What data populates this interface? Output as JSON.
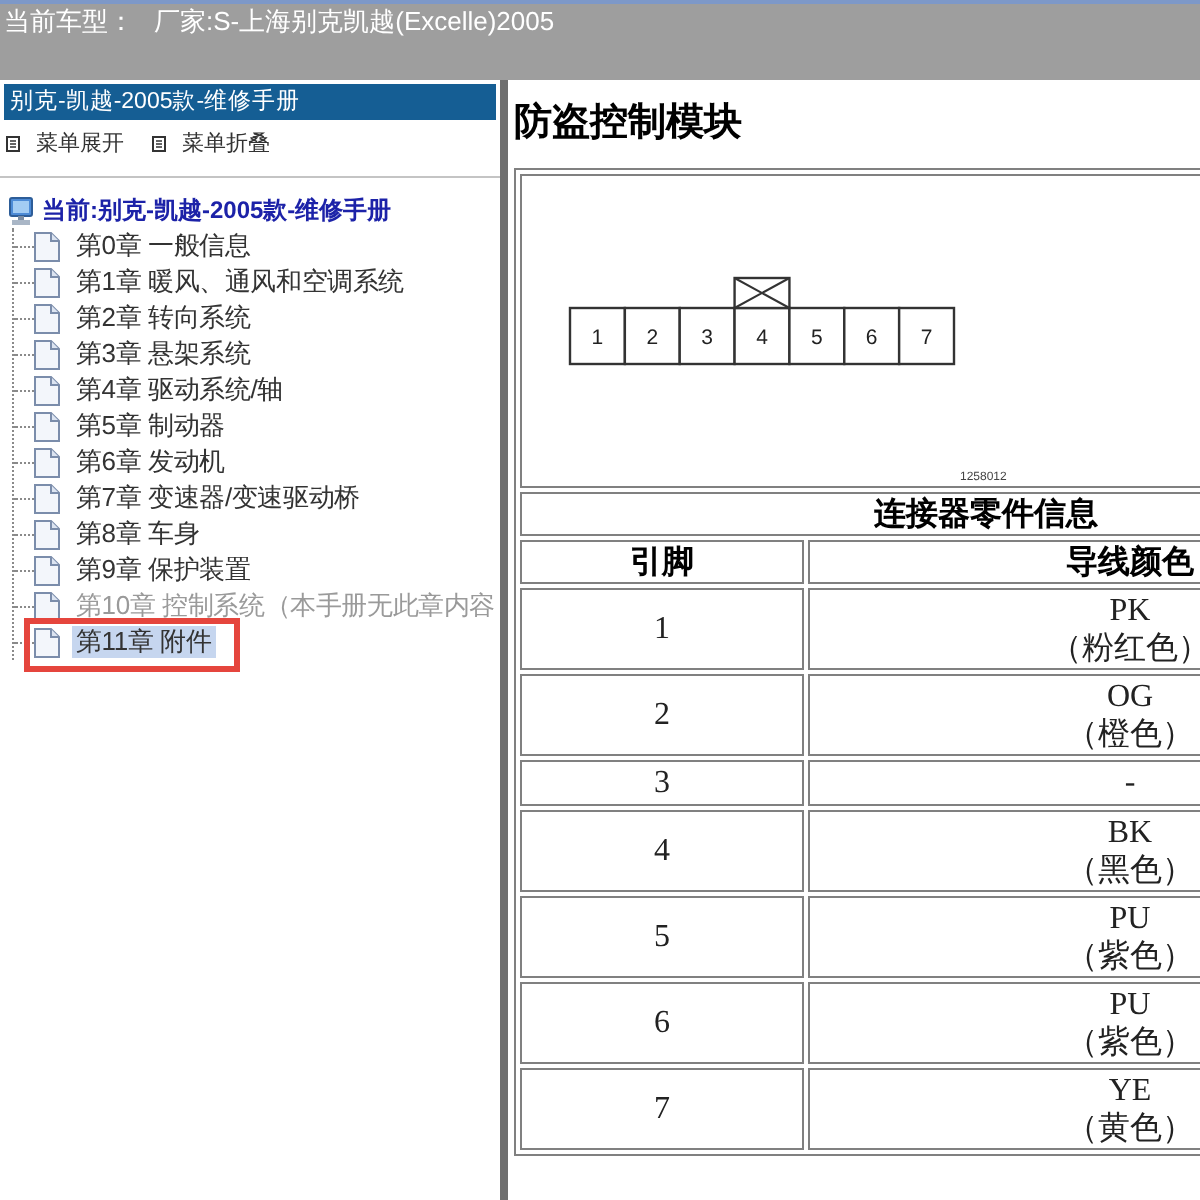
{
  "header": {
    "label": "当前车型：",
    "value": "厂家:S-上海别克凯越(Excelle)2005"
  },
  "sidebar": {
    "title": "别克-凯越-2005款-维修手册",
    "menu_actions": [
      {
        "label": "菜单展开"
      },
      {
        "label": "菜单折叠"
      }
    ],
    "tree": {
      "label": "当前:别克-凯越-2005款-维修手册",
      "children": [
        {
          "label": "第0章 一般信息",
          "selected": false,
          "disabled": false,
          "highlighted": false
        },
        {
          "label": "第1章 暖风、通风和空调系统",
          "selected": false,
          "disabled": false,
          "highlighted": false
        },
        {
          "label": "第2章 转向系统",
          "selected": false,
          "disabled": false,
          "highlighted": false
        },
        {
          "label": "第3章 悬架系统",
          "selected": false,
          "disabled": false,
          "highlighted": false
        },
        {
          "label": "第4章 驱动系统/轴",
          "selected": false,
          "disabled": false,
          "highlighted": false
        },
        {
          "label": "第5章 制动器",
          "selected": false,
          "disabled": false,
          "highlighted": false
        },
        {
          "label": "第6章 发动机",
          "selected": false,
          "disabled": false,
          "highlighted": false
        },
        {
          "label": "第7章 变速器/变速驱动桥",
          "selected": false,
          "disabled": false,
          "highlighted": false
        },
        {
          "label": "第8章 车身",
          "selected": false,
          "disabled": false,
          "highlighted": false
        },
        {
          "label": "第9章 保护装置",
          "selected": false,
          "disabled": false,
          "highlighted": false
        },
        {
          "label": "第10章 控制系统（本手册无此章内容",
          "selected": false,
          "disabled": true,
          "highlighted": false
        },
        {
          "label": "第11章 附件",
          "selected": true,
          "disabled": false,
          "highlighted": true
        }
      ]
    }
  },
  "content": {
    "title": "防盗控制模块",
    "connector": {
      "pins": [
        {
          "label": "1",
          "keyed": false
        },
        {
          "label": "2",
          "keyed": false
        },
        {
          "label": "3",
          "keyed": false
        },
        {
          "label": "4",
          "keyed": true
        },
        {
          "label": "5",
          "keyed": false
        },
        {
          "label": "6",
          "keyed": false
        },
        {
          "label": "7",
          "keyed": false
        }
      ],
      "drawing_number": "1258012"
    },
    "table": {
      "caption": "连接器零件信息",
      "columns": [
        "引脚",
        "导线颜色"
      ],
      "rows": [
        {
          "pin": "1",
          "wire_code": "PK",
          "wire_color": "（粉红色）"
        },
        {
          "pin": "2",
          "wire_code": "OG",
          "wire_color": "（橙色）"
        },
        {
          "pin": "3",
          "wire_code": "-"
        },
        {
          "pin": "4",
          "wire_code": "BK",
          "wire_color": "（黑色）"
        },
        {
          "pin": "5",
          "wire_code": "PU",
          "wire_color": "（紫色）"
        },
        {
          "pin": "6",
          "wire_code": "PU",
          "wire_color": "（紫色）"
        },
        {
          "pin": "7",
          "wire_code": "YE",
          "wire_color": "（黄色）"
        }
      ]
    }
  }
}
